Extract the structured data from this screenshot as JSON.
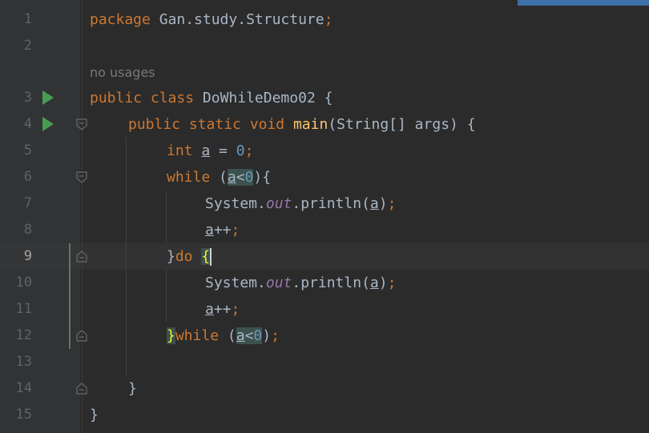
{
  "editor": {
    "line_numbers": [
      "1",
      "2",
      "3",
      "4",
      "5",
      "6",
      "7",
      "8",
      "9",
      "10",
      "11",
      "12",
      "13",
      "14",
      "15"
    ],
    "current_line": "9",
    "usage_hint": "no usages",
    "code": {
      "l1_kw": "package",
      "l1_rest": " Gan.study.Structure",
      "l1_semi": ";",
      "l3_kw1": "public",
      "l3_kw2": "class",
      "l3_name": " DoWhileDemo02 {",
      "l4_kw1": "public",
      "l4_kw2": "static",
      "l4_kw3": "void",
      "l4_fn": "main",
      "l4_rest": "(String[] args) {",
      "l5_kw": "int",
      "l5_var": "a",
      "l5_eq": " = ",
      "l5_num": "0",
      "l5_semi": ";",
      "l6_kw": "while",
      "l6_open": " (",
      "l6_var": "a",
      "l6_lt": "<",
      "l6_num": "0",
      "l6_close": "){",
      "l7_sys": "System.",
      "l7_out": "out",
      "l7_print": ".println(",
      "l7_var": "a",
      "l7_close": ")",
      "l7_semi": ";",
      "l8_var": "a",
      "l8_inc": "++",
      "l8_semi": ";",
      "l9_brace": "}",
      "l9_kw": "do",
      "l9_open": "{",
      "l10_sys": "System.",
      "l10_out": "out",
      "l10_print": ".println(",
      "l10_var": "a",
      "l10_close": ")",
      "l10_semi": ";",
      "l11_var": "a",
      "l11_inc": "++",
      "l11_semi": ";",
      "l12_brace": "}",
      "l12_kw": "while",
      "l12_open": " (",
      "l12_var": "a",
      "l12_lt": "<",
      "l12_num": "0",
      "l12_close": ")",
      "l12_semi": ";",
      "l14_brace": "}",
      "l15_brace": "}"
    }
  },
  "icons": {
    "run": "run-triangle-icon",
    "fold": "fold-marker-icon"
  },
  "colors": {
    "background": "#2b2b2b",
    "keyword": "#cc7832",
    "number": "#6897bb",
    "method": "#ffc66d",
    "field": "#9876aa",
    "run_icon": "#499c54"
  }
}
